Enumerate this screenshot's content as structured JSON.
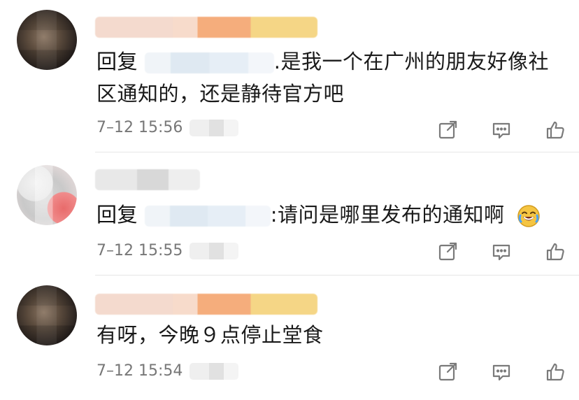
{
  "comments": [
    {
      "reply_prefix": "回复",
      "text": ".是我一个在广州的朋友好像社区通知的，还是静待官方吧",
      "time": "7–12 15:56"
    },
    {
      "reply_prefix": "回复",
      "text": ":请问是哪里发布的通知啊",
      "time": "7–12 15:55",
      "emoji": "laugh-cry-emoji"
    },
    {
      "text": "有呀，今晚９点停止堂食",
      "time": "7–12 15:54"
    }
  ],
  "icons": [
    "share-icon",
    "comment-icon",
    "like-icon"
  ],
  "colors": {
    "text": "#1a1a1a",
    "muted": "#777777",
    "divider": "#e6e6e6",
    "icon": "#7a7a7a"
  }
}
